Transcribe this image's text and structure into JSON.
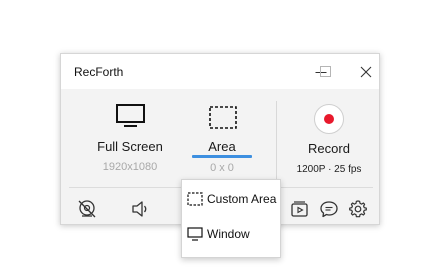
{
  "window": {
    "title": "RecForth",
    "controls": [
      "minimize-icon",
      "maximize-icon",
      "close-icon"
    ]
  },
  "modes": [
    {
      "id": "full_screen",
      "label": "Full Screen",
      "sub": "1920x1080",
      "icon": "monitor-icon",
      "selected": false
    },
    {
      "id": "area",
      "label": "Area",
      "sub": "0 x 0",
      "icon": "dashed-selection-icon",
      "selected": true
    }
  ],
  "record": {
    "label": "Record",
    "settings": "1200P · 25 fps",
    "icon": "record-icon"
  },
  "toolbar": {
    "icons": [
      "webcam-off-icon",
      "speaker-icon",
      "video-library-icon",
      "chat-bubble-icon",
      "gear-icon"
    ]
  },
  "area_menu": {
    "items": [
      {
        "label": "Custom Area",
        "icon": "dashed-selection-icon"
      },
      {
        "label": "Window",
        "icon": "monitor-icon"
      }
    ]
  },
  "colors": {
    "accent": "#3d8fe0",
    "record_red": "#e8192c",
    "window_bg": "#f3f3f3",
    "sub_text": "#a8a8a8"
  }
}
